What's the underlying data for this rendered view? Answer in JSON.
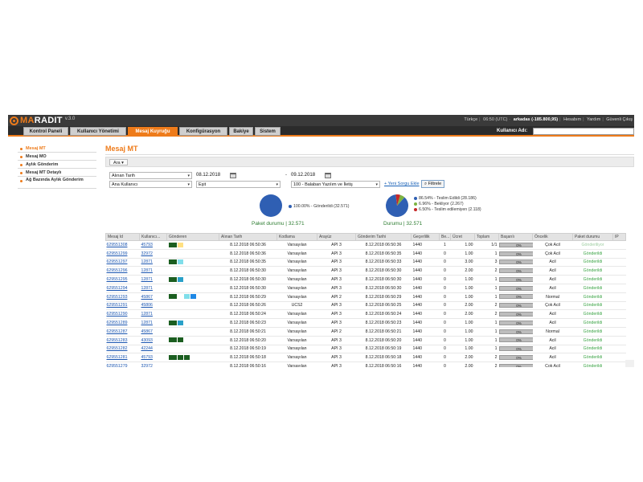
{
  "header": {
    "logo_prefix": "MA",
    "logo_rest": "RADIT",
    "version": "v.3.0",
    "language": "Türkçe",
    "time": "06:50 (UTC)",
    "account": "arkadas (-185.800,95)",
    "links": [
      "Hesabım",
      "Yardım",
      "Güvenli Çıkış"
    ]
  },
  "nav": {
    "tabs": [
      "Kontrol Paneli",
      "Kullanıcı Yönetimi",
      "Mesaj Kuyruğu",
      "Konfigürasyon",
      "Bakiye",
      "Sistem"
    ],
    "active_tab": "Mesaj Kuyruğu",
    "user_label": "Kullanıcı Adı:"
  },
  "sidebar": {
    "items": [
      {
        "label": "Mesaj MT"
      },
      {
        "label": "Mesaj MO"
      },
      {
        "label": "Aylık Gönderim"
      },
      {
        "label": "Mesaj MT Detaylı"
      },
      {
        "label": "Ağ Bazında Aylık Gönderim"
      }
    ],
    "active_item": "Mesaj MT"
  },
  "main": {
    "title": "Mesaj MT",
    "search_toggle": "Ara"
  },
  "filters": {
    "date_field": "Alınan Tarih",
    "date_from": "08.12.2018",
    "date_to": "09.12.2018",
    "user_field": "Ana Kullanıcı",
    "operator": "Eşit",
    "user_value": "100 - Balaban Yazılım ve İletiş",
    "new_query_link": "+ Yeni Sorgu Ekle",
    "filter_button": "Filtrele"
  },
  "charts": {
    "packet": {
      "legend": "100.00% - Gönderildi (32.571)",
      "caption": "Paket durumu | 32.571",
      "color": "#2f5fb3"
    },
    "status": {
      "legend": [
        {
          "text": "86.54% - Teslim Edildi (28.186)",
          "color": "#2f5fb3"
        },
        {
          "text": "6.96% - Bekliyor (2.267)",
          "color": "#7cb342"
        },
        {
          "text": "6.50% - Teslim edilemiyen (2.118)",
          "color": "#c62828"
        }
      ],
      "caption": "Durumu | 32.571"
    }
  },
  "chart_data": [
    {
      "type": "pie",
      "categories": [
        "Gönderildi"
      ],
      "values": [
        32571
      ],
      "percentages": [
        100.0
      ],
      "title": "Paket durumu | 32.571"
    },
    {
      "type": "pie",
      "categories": [
        "Teslim Edildi",
        "Bekliyor",
        "Teslim edilemiyen"
      ],
      "values": [
        28186,
        2267,
        2118
      ],
      "percentages": [
        86.54,
        6.96,
        6.5
      ],
      "title": "Durumu | 32.571"
    }
  ],
  "table": {
    "columns": [
      "Mesaj Id",
      "Kullanıcı...",
      "Gönderen",
      "Alınan Tarih",
      "Kodlama",
      "Arayüz",
      "Gönderim Tarihi",
      "Geçerlilik",
      "Be...",
      "Ücret",
      "Toplam",
      "Başarılı",
      "Öncelik",
      "Paket durumu",
      "IP"
    ],
    "rows": [
      {
        "id": "629551308",
        "user": "45793",
        "sender_colors": [
          "#1b5e20",
          "#ffe082"
        ],
        "received": "8.12.2018 06:50:36",
        "encoding": "Varsayılan",
        "interface": "API 3",
        "sent": "8.12.2018 06:50:36",
        "validity": "1440",
        "be": "1",
        "fee": "1.00",
        "total": "1/1",
        "success": "0%",
        "priority": "Çok Acil",
        "packet": "Gönderiliyor"
      },
      {
        "id": "629551299",
        "user": "32972",
        "sender_colors": [],
        "received": "8.12.2018 06:50:36",
        "encoding": "Varsayılan",
        "interface": "API 3",
        "sent": "8.12.2018 06:50:35",
        "validity": "1440",
        "be": "0",
        "fee": "1.00",
        "total": "1",
        "success": "0%",
        "priority": "Çok Acil",
        "packet": "Gönderildi"
      },
      {
        "id": "629551297",
        "user": "12871",
        "sender_colors": [
          "#1b5e20",
          "#80deea"
        ],
        "received": "8.12.2018 06:50:35",
        "encoding": "Varsayılan",
        "interface": "API 3",
        "sent": "8.12.2018 06:50:33",
        "validity": "1440",
        "be": "0",
        "fee": "3.00",
        "total": "3",
        "success": "0%",
        "priority": "Acil",
        "packet": "Gönderildi"
      },
      {
        "id": "629551296",
        "user": "12871",
        "sender_colors": [],
        "received": "8.12.2018 06:50:30",
        "encoding": "Varsayılan",
        "interface": "API 3",
        "sent": "8.12.2018 06:50:30",
        "validity": "1440",
        "be": "0",
        "fee": "2.00",
        "total": "2",
        "success": "0%",
        "priority": "Acil",
        "packet": "Gönderildi"
      },
      {
        "id": "629551295",
        "user": "12871",
        "sender_colors": [
          "#1b5e20",
          "#29a0c8"
        ],
        "received": "8.12.2018 06:50:30",
        "encoding": "Varsayılan",
        "interface": "API 3",
        "sent": "8.12.2018 06:50:30",
        "validity": "1440",
        "be": "0",
        "fee": "1.00",
        "total": "1",
        "success": "0%",
        "priority": "Acil",
        "packet": "Gönderildi"
      },
      {
        "id": "629551294",
        "user": "12871",
        "sender_colors": [],
        "received": "8.12.2018 06:50:30",
        "encoding": "Varsayılan",
        "interface": "API 3",
        "sent": "8.12.2018 06:50:30",
        "validity": "1440",
        "be": "0",
        "fee": "1.00",
        "total": "1",
        "success": "0%",
        "priority": "Acil",
        "packet": "Gönderildi"
      },
      {
        "id": "629551293",
        "user": "45867",
        "sender_colors": [
          "#1b5e20",
          "#ffffff",
          "#80deea",
          "#1e88e5"
        ],
        "received": "8.12.2018 06:50:29",
        "encoding": "Varsayılan",
        "interface": "API 2",
        "sent": "8.12.2018 06:50:29",
        "validity": "1440",
        "be": "0",
        "fee": "1.00",
        "total": "1",
        "success": "0%",
        "priority": "Normal",
        "packet": "Gönderildi"
      },
      {
        "id": "629551291",
        "user": "45806",
        "sender_colors": [],
        "received": "8.12.2018 06:50:26",
        "encoding": "UCS2",
        "interface": "API 3",
        "sent": "8.12.2018 06:50:25",
        "validity": "1440",
        "be": "0",
        "fee": "2.00",
        "total": "2",
        "success": "0%",
        "priority": "Çok Acil",
        "packet": "Gönderildi"
      },
      {
        "id": "629551290",
        "user": "12871",
        "sender_colors": [],
        "received": "8.12.2018 06:50:24",
        "encoding": "Varsayılan",
        "interface": "API 3",
        "sent": "8.12.2018 06:50:24",
        "validity": "1440",
        "be": "0",
        "fee": "2.00",
        "total": "2",
        "success": "0%",
        "priority": "Acil",
        "packet": "Gönderildi"
      },
      {
        "id": "629551289",
        "user": "12871",
        "sender_colors": [
          "#1b5e20",
          "#29a0c8"
        ],
        "received": "8.12.2018 06:50:23",
        "encoding": "Varsayılan",
        "interface": "API 3",
        "sent": "8.12.2018 06:50:23",
        "validity": "1440",
        "be": "0",
        "fee": "1.00",
        "total": "1",
        "success": "0%",
        "priority": "Acil",
        "packet": "Gönderildi"
      },
      {
        "id": "629551287",
        "user": "45867",
        "sender_colors": [],
        "received": "8.12.2018 06:50:21",
        "encoding": "Varsayılan",
        "interface": "API 2",
        "sent": "8.12.2018 06:50:21",
        "validity": "1440",
        "be": "0",
        "fee": "1.00",
        "total": "1",
        "success": "0%",
        "priority": "Normal",
        "packet": "Gönderildi"
      },
      {
        "id": "629551283",
        "user": "43093",
        "sender_colors": [
          "#1b5e20",
          "#1b5e20"
        ],
        "received": "8.12.2018 06:50:20",
        "encoding": "Varsayılan",
        "interface": "API 3",
        "sent": "8.12.2018 06:50:20",
        "validity": "1440",
        "be": "0",
        "fee": "1.00",
        "total": "1",
        "success": "0%",
        "priority": "Acil",
        "packet": "Gönderildi"
      },
      {
        "id": "629551282",
        "user": "42244",
        "sender_colors": [],
        "received": "8.12.2018 06:50:19",
        "encoding": "Varsayılan",
        "interface": "API 3",
        "sent": "8.12.2018 06:50:19",
        "validity": "1440",
        "be": "0",
        "fee": "1.00",
        "total": "1",
        "success": "0%",
        "priority": "Acil",
        "packet": "Gönderildi"
      },
      {
        "id": "629551281",
        "user": "45793",
        "sender_colors": [
          "#1b5e20",
          "#1b5e20",
          "#1b5e20"
        ],
        "received": "8.12.2018 06:50:18",
        "encoding": "Varsayılan",
        "interface": "API 3",
        "sent": "8.12.2018 06:50:18",
        "validity": "1440",
        "be": "0",
        "fee": "2.00",
        "total": "2",
        "success": "0%",
        "priority": "Acil",
        "packet": "Gönderildi"
      },
      {
        "id": "629551279",
        "user": "32972",
        "sender_colors": [],
        "received": "8.12.2018 06:50:16",
        "encoding": "Varsayılan",
        "interface": "API 3",
        "sent": "8.12.2018 06:50:16",
        "validity": "1440",
        "be": "0",
        "fee": "2.00",
        "total": "2",
        "success": "0%",
        "priority": "Çok Acil",
        "packet": "Gönderildi"
      }
    ]
  },
  "colors": {
    "accent": "#ee7b1a",
    "header_bg": "#3a3a3a",
    "link": "#1a55b0",
    "sent_green": "#3ba445"
  }
}
